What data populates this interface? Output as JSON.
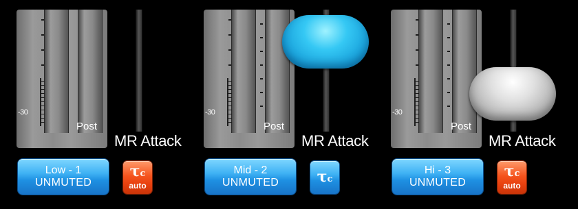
{
  "meter": {
    "scale_label": "-30",
    "post_label": "Post"
  },
  "attack_label": "MR Attack",
  "tau": {
    "symbol": "τ",
    "subscript": "c",
    "auto_label": "auto"
  },
  "colors": {
    "button_blue": "#1e90e2",
    "button_orange": "#e8410f",
    "background": "#000000"
  },
  "bands": [
    {
      "name": "Low - 1",
      "status": "UNMUTED",
      "tau_mode": "auto",
      "knob": "none"
    },
    {
      "name": "Mid - 2",
      "status": "UNMUTED",
      "tau_mode": "manual",
      "knob": "blue"
    },
    {
      "name": "Hi - 3",
      "status": "UNMUTED",
      "tau_mode": "auto",
      "knob": "silver"
    }
  ]
}
